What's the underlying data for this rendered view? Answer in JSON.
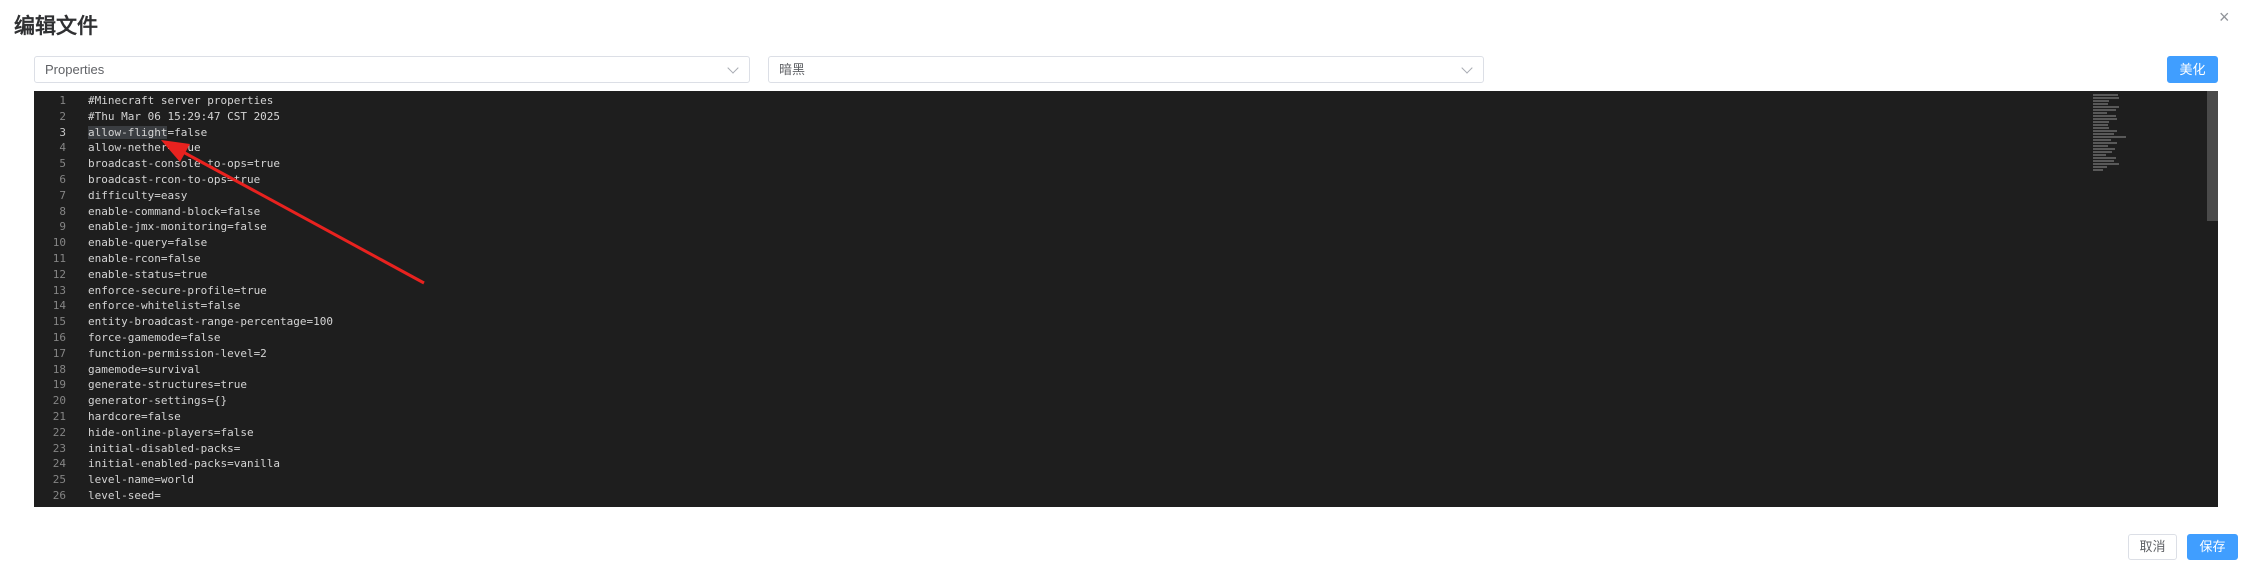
{
  "dialog": {
    "title": "编辑文件",
    "close_icon": "×"
  },
  "toolbar": {
    "language_value": "Properties",
    "theme_value": "暗黑",
    "beautify_label": "美化"
  },
  "editor": {
    "active_line": 3,
    "highlighted_word": "allow-flight",
    "lines": [
      "#Minecraft server properties",
      "#Thu Mar 06 15:29:47 CST 2025",
      "allow-flight=false",
      "allow-nether=true",
      "broadcast-console-to-ops=true",
      "broadcast-rcon-to-ops=true",
      "difficulty=easy",
      "enable-command-block=false",
      "enable-jmx-monitoring=false",
      "enable-query=false",
      "enable-rcon=false",
      "enable-status=true",
      "enforce-secure-profile=true",
      "enforce-whitelist=false",
      "entity-broadcast-range-percentage=100",
      "force-gamemode=false",
      "function-permission-level=2",
      "gamemode=survival",
      "generate-structures=true",
      "generator-settings={}",
      "hardcore=false",
      "hide-online-players=false",
      "initial-disabled-packs=",
      "initial-enabled-packs=vanilla",
      "level-name=world",
      "level-seed="
    ]
  },
  "footer": {
    "cancel_label": "取消",
    "save_label": "保存"
  },
  "colors": {
    "primary": "#409eff",
    "editor_bg": "#1e1e1e",
    "annotation_arrow": "#e8221f"
  }
}
